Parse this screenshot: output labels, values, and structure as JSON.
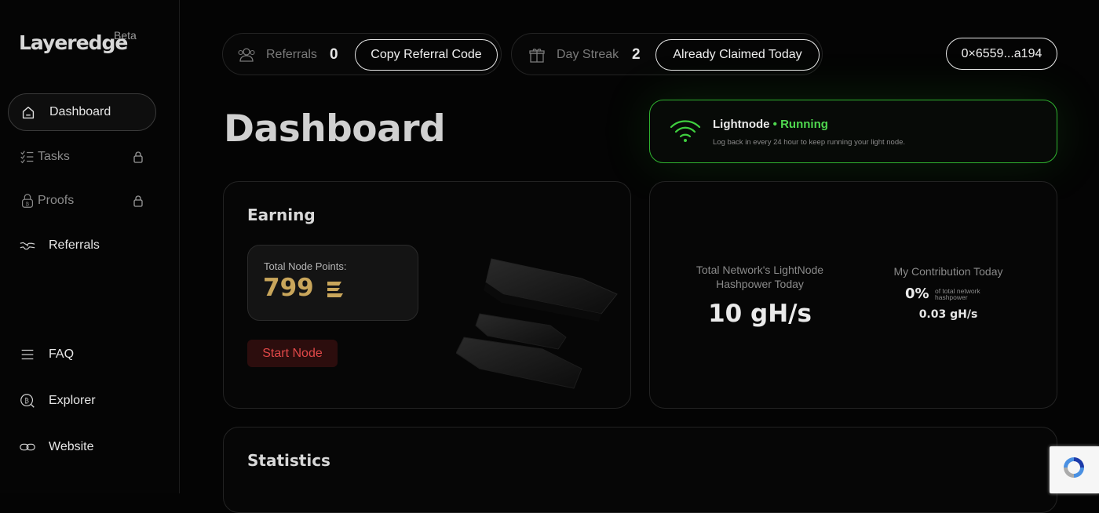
{
  "sidebar": {
    "logo": "Layeredge",
    "beta": "Beta",
    "items": [
      {
        "label": "Dashboard",
        "icon": "home-icon",
        "active": true
      },
      {
        "label": "Tasks",
        "icon": "tasks-icon",
        "locked": true
      },
      {
        "label": "Proofs",
        "icon": "proofs-icon",
        "locked": true
      },
      {
        "label": "Referrals",
        "icon": "handshake-icon"
      },
      {
        "label": "FAQ",
        "icon": "menu-icon"
      },
      {
        "label": "Explorer",
        "icon": "explorer-icon"
      },
      {
        "label": "Website",
        "icon": "link-icon"
      }
    ]
  },
  "topbar": {
    "referrals_label": "Referrals",
    "referrals_count": "0",
    "copy_button": "Copy Referral Code",
    "streak_label": "Day Streak",
    "streak_count": "2",
    "claim_button": "Already Claimed Today",
    "wallet": "0×6559...a194"
  },
  "main": {
    "title": "Dashboard",
    "lightnode": {
      "name": "Lightnode",
      "dot": "•",
      "status": "Running",
      "desc": "Log back in every 24 hour to keep running your light node."
    },
    "earning": {
      "title": "Earning",
      "points_label": "Total Node Points:",
      "points_value": "799",
      "start_button": "Start Node"
    },
    "network": {
      "total_label_1": "Total Network's LightNode",
      "total_label_2": "Hashpower Today",
      "total_value": "10 gH/s",
      "contrib_label": "My Contribution Today",
      "contrib_percent": "0%",
      "contrib_note_1": "of total network",
      "contrib_note_2": "hashpower",
      "contrib_value": "0.03 gH/s"
    },
    "statistics": {
      "title": "Statistics"
    }
  },
  "colors": {
    "accent_green": "#4fd84f",
    "points_gold": "#c9a65b",
    "start_red": "#e04848"
  }
}
